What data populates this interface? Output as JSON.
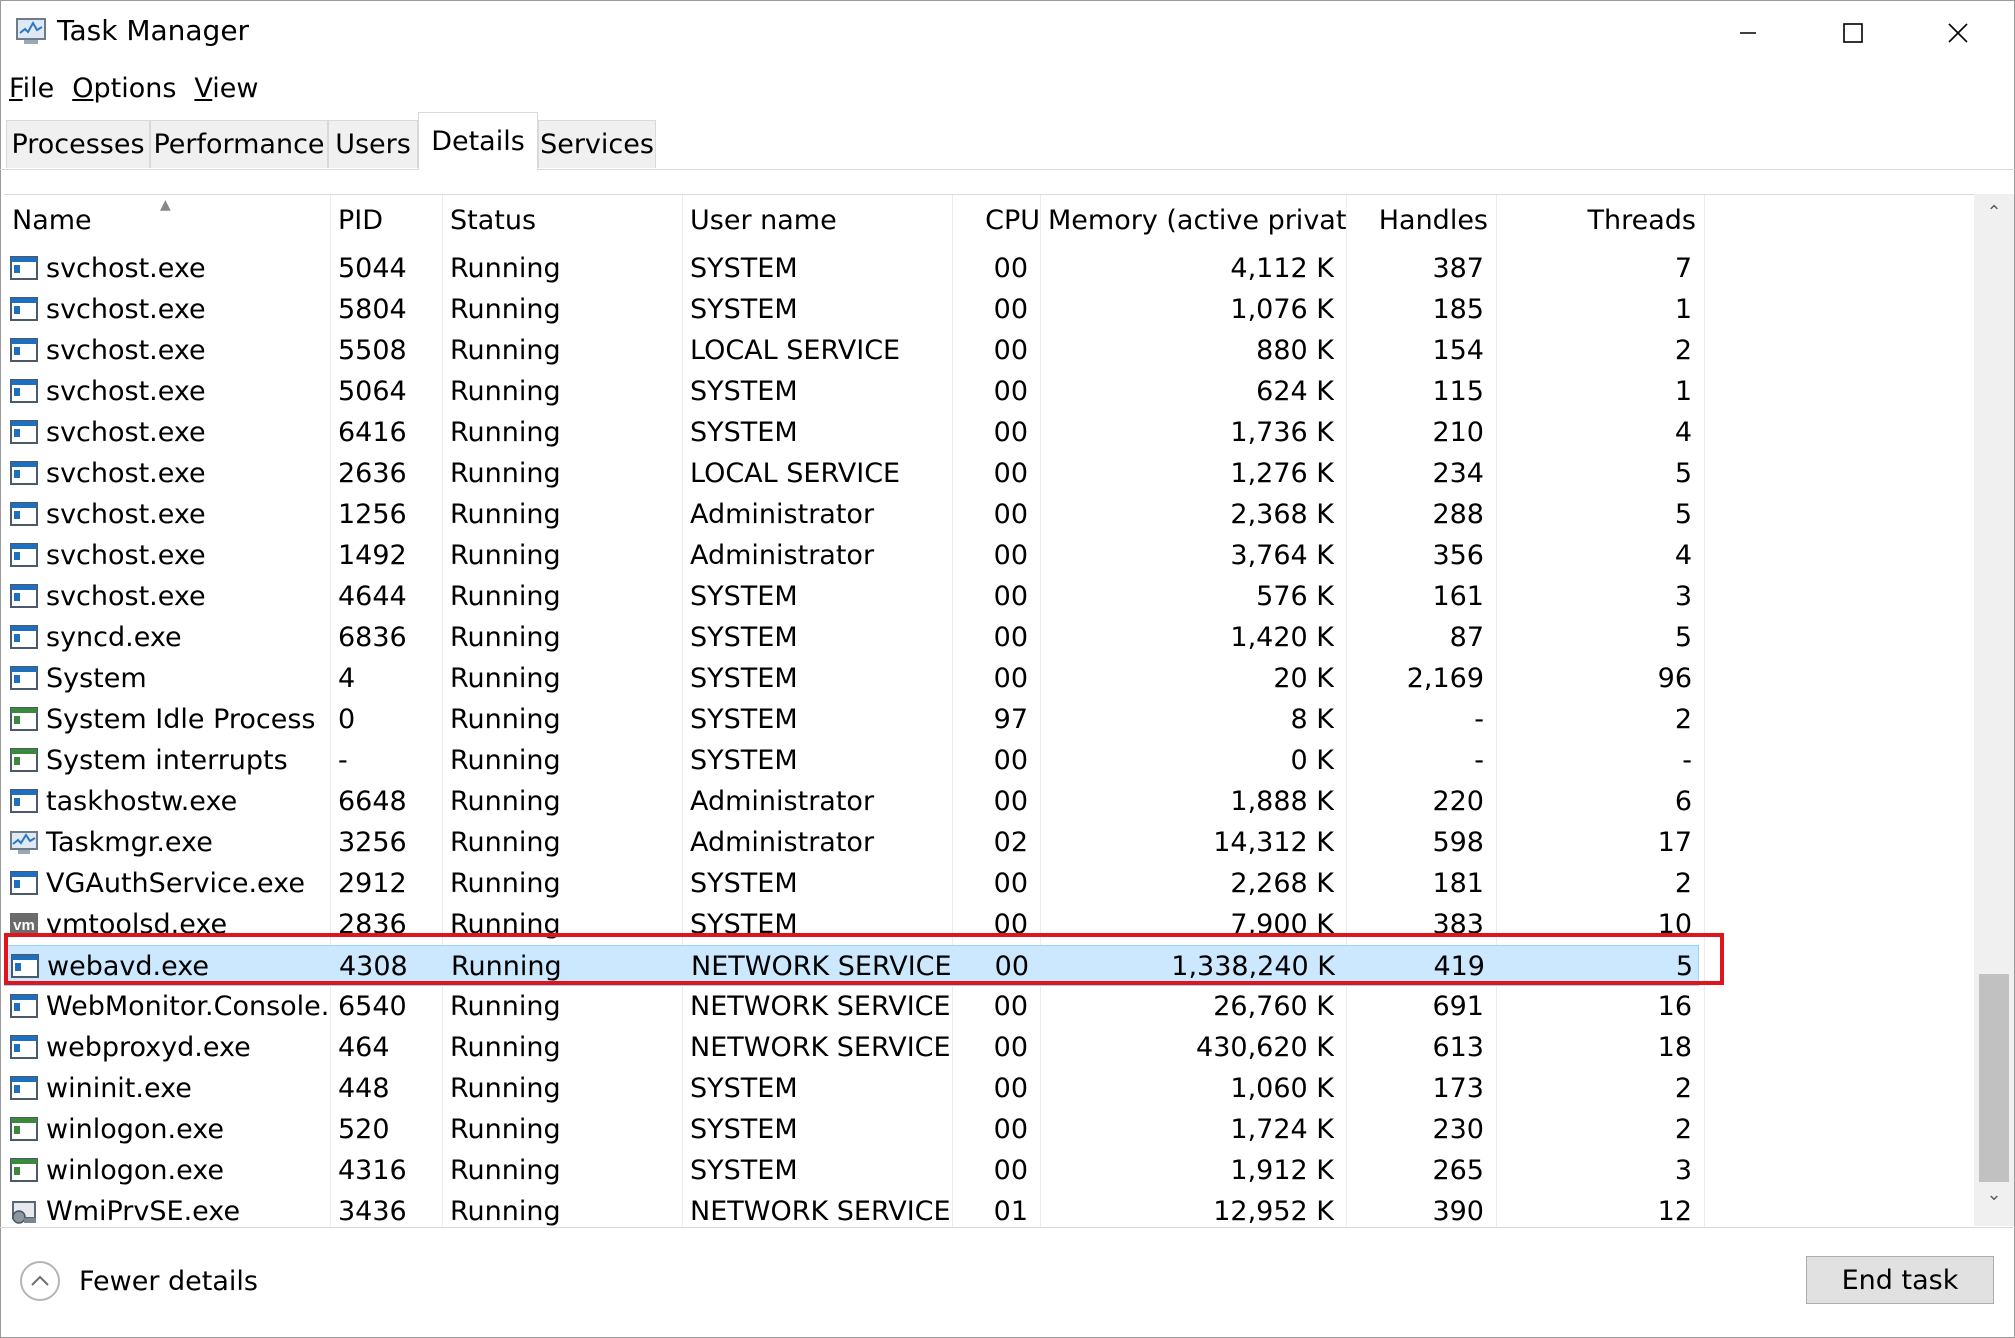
{
  "window": {
    "title": "Task Manager"
  },
  "menu": [
    {
      "label": "File",
      "key": "F",
      "rest": "ile"
    },
    {
      "label": "Options",
      "key": "O",
      "rest": "ptions"
    },
    {
      "label": "View",
      "key": "V",
      "rest": "iew"
    }
  ],
  "tabs": [
    {
      "label": "Processes",
      "active": false
    },
    {
      "label": "Performance",
      "active": false
    },
    {
      "label": "Users",
      "active": false
    },
    {
      "label": "Details",
      "active": true
    },
    {
      "label": "Services",
      "active": false
    }
  ],
  "columns": {
    "name": "Name",
    "pid": "PID",
    "status": "Status",
    "user": "User name",
    "cpu": "CPU",
    "memory": "Memory (active private...",
    "handles": "Handles",
    "threads": "Threads"
  },
  "rows": [
    {
      "name": "svchost.exe",
      "pid": "5044",
      "status": "Running",
      "user": "SYSTEM",
      "cpu": "00",
      "memory": "4,112 K",
      "handles": "387",
      "threads": "7",
      "icon": "service-window-icon"
    },
    {
      "name": "svchost.exe",
      "pid": "5804",
      "status": "Running",
      "user": "SYSTEM",
      "cpu": "00",
      "memory": "1,076 K",
      "handles": "185",
      "threads": "1",
      "icon": "service-window-icon"
    },
    {
      "name": "svchost.exe",
      "pid": "5508",
      "status": "Running",
      "user": "LOCAL SERVICE",
      "cpu": "00",
      "memory": "880 K",
      "handles": "154",
      "threads": "2",
      "icon": "service-window-icon"
    },
    {
      "name": "svchost.exe",
      "pid": "5064",
      "status": "Running",
      "user": "SYSTEM",
      "cpu": "00",
      "memory": "624 K",
      "handles": "115",
      "threads": "1",
      "icon": "service-window-icon"
    },
    {
      "name": "svchost.exe",
      "pid": "6416",
      "status": "Running",
      "user": "SYSTEM",
      "cpu": "00",
      "memory": "1,736 K",
      "handles": "210",
      "threads": "4",
      "icon": "service-window-icon"
    },
    {
      "name": "svchost.exe",
      "pid": "2636",
      "status": "Running",
      "user": "LOCAL SERVICE",
      "cpu": "00",
      "memory": "1,276 K",
      "handles": "234",
      "threads": "5",
      "icon": "service-window-icon"
    },
    {
      "name": "svchost.exe",
      "pid": "1256",
      "status": "Running",
      "user": "Administrator",
      "cpu": "00",
      "memory": "2,368 K",
      "handles": "288",
      "threads": "5",
      "icon": "service-window-icon"
    },
    {
      "name": "svchost.exe",
      "pid": "1492",
      "status": "Running",
      "user": "Administrator",
      "cpu": "00",
      "memory": "3,764 K",
      "handles": "356",
      "threads": "4",
      "icon": "service-window-icon"
    },
    {
      "name": "svchost.exe",
      "pid": "4644",
      "status": "Running",
      "user": "SYSTEM",
      "cpu": "00",
      "memory": "576 K",
      "handles": "161",
      "threads": "3",
      "icon": "service-window-icon"
    },
    {
      "name": "syncd.exe",
      "pid": "6836",
      "status": "Running",
      "user": "SYSTEM",
      "cpu": "00",
      "memory": "1,420 K",
      "handles": "87",
      "threads": "5",
      "icon": "service-window-icon"
    },
    {
      "name": "System",
      "pid": "4",
      "status": "Running",
      "user": "SYSTEM",
      "cpu": "00",
      "memory": "20 K",
      "handles": "2,169",
      "threads": "96",
      "icon": "service-window-icon"
    },
    {
      "name": "System Idle Process",
      "pid": "0",
      "status": "Running",
      "user": "SYSTEM",
      "cpu": "97",
      "memory": "8 K",
      "handles": "-",
      "threads": "2",
      "icon": "system-window-icon"
    },
    {
      "name": "System interrupts",
      "pid": "-",
      "status": "Running",
      "user": "SYSTEM",
      "cpu": "00",
      "memory": "0 K",
      "handles": "-",
      "threads": "-",
      "icon": "system-window-icon"
    },
    {
      "name": "taskhostw.exe",
      "pid": "6648",
      "status": "Running",
      "user": "Administrator",
      "cpu": "00",
      "memory": "1,888 K",
      "handles": "220",
      "threads": "6",
      "icon": "service-window-icon"
    },
    {
      "name": "Taskmgr.exe",
      "pid": "3256",
      "status": "Running",
      "user": "Administrator",
      "cpu": "02",
      "memory": "14,312 K",
      "handles": "598",
      "threads": "17",
      "icon": "task-manager-icon"
    },
    {
      "name": "VGAuthService.exe",
      "pid": "2912",
      "status": "Running",
      "user": "SYSTEM",
      "cpu": "00",
      "memory": "2,268 K",
      "handles": "181",
      "threads": "2",
      "icon": "service-window-icon"
    },
    {
      "name": "vmtoolsd.exe",
      "pid": "2836",
      "status": "Running",
      "user": "SYSTEM",
      "cpu": "00",
      "memory": "7,900 K",
      "handles": "383",
      "threads": "10",
      "icon": "vm-icon"
    },
    {
      "name": "webavd.exe",
      "pid": "4308",
      "status": "Running",
      "user": "NETWORK SERVICE",
      "cpu": "00",
      "memory": "1,338,240 K",
      "handles": "419",
      "threads": "5",
      "icon": "service-window-icon",
      "selected": true
    },
    {
      "name": "WebMonitor.Console....",
      "pid": "6540",
      "status": "Running",
      "user": "NETWORK SERVICE",
      "cpu": "00",
      "memory": "26,760 K",
      "handles": "691",
      "threads": "16",
      "icon": "service-window-icon"
    },
    {
      "name": "webproxyd.exe",
      "pid": "464",
      "status": "Running",
      "user": "NETWORK SERVICE",
      "cpu": "00",
      "memory": "430,620 K",
      "handles": "613",
      "threads": "18",
      "icon": "service-window-icon"
    },
    {
      "name": "wininit.exe",
      "pid": "448",
      "status": "Running",
      "user": "SYSTEM",
      "cpu": "00",
      "memory": "1,060 K",
      "handles": "173",
      "threads": "2",
      "icon": "service-window-icon"
    },
    {
      "name": "winlogon.exe",
      "pid": "520",
      "status": "Running",
      "user": "SYSTEM",
      "cpu": "00",
      "memory": "1,724 K",
      "handles": "230",
      "threads": "2",
      "icon": "system-window-icon"
    },
    {
      "name": "winlogon.exe",
      "pid": "4316",
      "status": "Running",
      "user": "SYSTEM",
      "cpu": "00",
      "memory": "1,912 K",
      "handles": "265",
      "threads": "3",
      "icon": "system-window-icon"
    },
    {
      "name": "WmiPrvSE.exe",
      "pid": "3436",
      "status": "Running",
      "user": "NETWORK SERVICE",
      "cpu": "01",
      "memory": "12,952 K",
      "handles": "390",
      "threads": "12",
      "icon": "wmi-provider-icon"
    }
  ],
  "footer": {
    "fewer_details": "Fewer details",
    "end_task": "End task"
  },
  "colors": {
    "selection": "#cce8ff",
    "selection_border": "#99d1ff",
    "highlight_box": "#e0151b",
    "accent": "#0078d7"
  }
}
